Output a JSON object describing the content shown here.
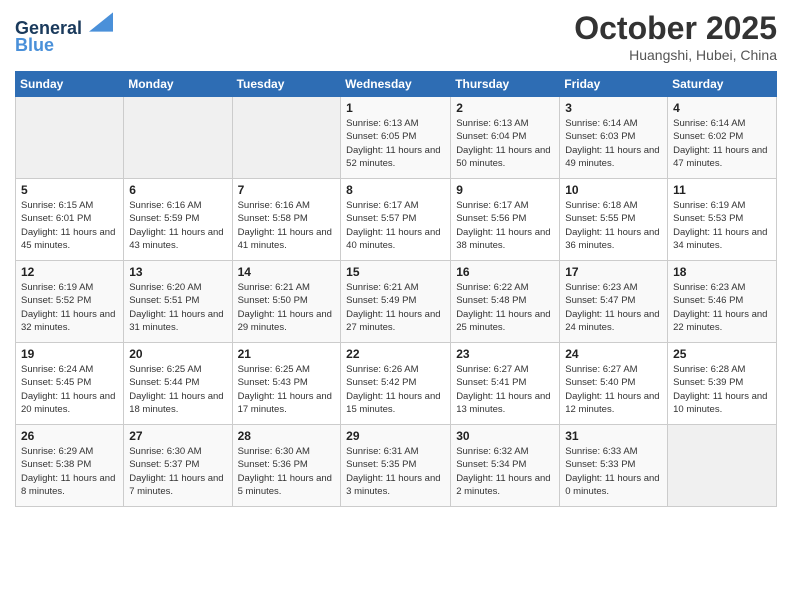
{
  "header": {
    "logo_line1": "General",
    "logo_line2": "Blue",
    "month_title": "October 2025",
    "location": "Huangshi, Hubei, China"
  },
  "weekdays": [
    "Sunday",
    "Monday",
    "Tuesday",
    "Wednesday",
    "Thursday",
    "Friday",
    "Saturday"
  ],
  "weeks": [
    [
      {
        "day": "",
        "sunrise": "",
        "sunset": "",
        "daylight": "",
        "empty": true
      },
      {
        "day": "",
        "sunrise": "",
        "sunset": "",
        "daylight": "",
        "empty": true
      },
      {
        "day": "",
        "sunrise": "",
        "sunset": "",
        "daylight": "",
        "empty": true
      },
      {
        "day": "1",
        "sunrise": "Sunrise: 6:13 AM",
        "sunset": "Sunset: 6:05 PM",
        "daylight": "Daylight: 11 hours and 52 minutes."
      },
      {
        "day": "2",
        "sunrise": "Sunrise: 6:13 AM",
        "sunset": "Sunset: 6:04 PM",
        "daylight": "Daylight: 11 hours and 50 minutes."
      },
      {
        "day": "3",
        "sunrise": "Sunrise: 6:14 AM",
        "sunset": "Sunset: 6:03 PM",
        "daylight": "Daylight: 11 hours and 49 minutes."
      },
      {
        "day": "4",
        "sunrise": "Sunrise: 6:14 AM",
        "sunset": "Sunset: 6:02 PM",
        "daylight": "Daylight: 11 hours and 47 minutes."
      }
    ],
    [
      {
        "day": "5",
        "sunrise": "Sunrise: 6:15 AM",
        "sunset": "Sunset: 6:01 PM",
        "daylight": "Daylight: 11 hours and 45 minutes."
      },
      {
        "day": "6",
        "sunrise": "Sunrise: 6:16 AM",
        "sunset": "Sunset: 5:59 PM",
        "daylight": "Daylight: 11 hours and 43 minutes."
      },
      {
        "day": "7",
        "sunrise": "Sunrise: 6:16 AM",
        "sunset": "Sunset: 5:58 PM",
        "daylight": "Daylight: 11 hours and 41 minutes."
      },
      {
        "day": "8",
        "sunrise": "Sunrise: 6:17 AM",
        "sunset": "Sunset: 5:57 PM",
        "daylight": "Daylight: 11 hours and 40 minutes."
      },
      {
        "day": "9",
        "sunrise": "Sunrise: 6:17 AM",
        "sunset": "Sunset: 5:56 PM",
        "daylight": "Daylight: 11 hours and 38 minutes."
      },
      {
        "day": "10",
        "sunrise": "Sunrise: 6:18 AM",
        "sunset": "Sunset: 5:55 PM",
        "daylight": "Daylight: 11 hours and 36 minutes."
      },
      {
        "day": "11",
        "sunrise": "Sunrise: 6:19 AM",
        "sunset": "Sunset: 5:53 PM",
        "daylight": "Daylight: 11 hours and 34 minutes."
      }
    ],
    [
      {
        "day": "12",
        "sunrise": "Sunrise: 6:19 AM",
        "sunset": "Sunset: 5:52 PM",
        "daylight": "Daylight: 11 hours and 32 minutes."
      },
      {
        "day": "13",
        "sunrise": "Sunrise: 6:20 AM",
        "sunset": "Sunset: 5:51 PM",
        "daylight": "Daylight: 11 hours and 31 minutes."
      },
      {
        "day": "14",
        "sunrise": "Sunrise: 6:21 AM",
        "sunset": "Sunset: 5:50 PM",
        "daylight": "Daylight: 11 hours and 29 minutes."
      },
      {
        "day": "15",
        "sunrise": "Sunrise: 6:21 AM",
        "sunset": "Sunset: 5:49 PM",
        "daylight": "Daylight: 11 hours and 27 minutes."
      },
      {
        "day": "16",
        "sunrise": "Sunrise: 6:22 AM",
        "sunset": "Sunset: 5:48 PM",
        "daylight": "Daylight: 11 hours and 25 minutes."
      },
      {
        "day": "17",
        "sunrise": "Sunrise: 6:23 AM",
        "sunset": "Sunset: 5:47 PM",
        "daylight": "Daylight: 11 hours and 24 minutes."
      },
      {
        "day": "18",
        "sunrise": "Sunrise: 6:23 AM",
        "sunset": "Sunset: 5:46 PM",
        "daylight": "Daylight: 11 hours and 22 minutes."
      }
    ],
    [
      {
        "day": "19",
        "sunrise": "Sunrise: 6:24 AM",
        "sunset": "Sunset: 5:45 PM",
        "daylight": "Daylight: 11 hours and 20 minutes."
      },
      {
        "day": "20",
        "sunrise": "Sunrise: 6:25 AM",
        "sunset": "Sunset: 5:44 PM",
        "daylight": "Daylight: 11 hours and 18 minutes."
      },
      {
        "day": "21",
        "sunrise": "Sunrise: 6:25 AM",
        "sunset": "Sunset: 5:43 PM",
        "daylight": "Daylight: 11 hours and 17 minutes."
      },
      {
        "day": "22",
        "sunrise": "Sunrise: 6:26 AM",
        "sunset": "Sunset: 5:42 PM",
        "daylight": "Daylight: 11 hours and 15 minutes."
      },
      {
        "day": "23",
        "sunrise": "Sunrise: 6:27 AM",
        "sunset": "Sunset: 5:41 PM",
        "daylight": "Daylight: 11 hours and 13 minutes."
      },
      {
        "day": "24",
        "sunrise": "Sunrise: 6:27 AM",
        "sunset": "Sunset: 5:40 PM",
        "daylight": "Daylight: 11 hours and 12 minutes."
      },
      {
        "day": "25",
        "sunrise": "Sunrise: 6:28 AM",
        "sunset": "Sunset: 5:39 PM",
        "daylight": "Daylight: 11 hours and 10 minutes."
      }
    ],
    [
      {
        "day": "26",
        "sunrise": "Sunrise: 6:29 AM",
        "sunset": "Sunset: 5:38 PM",
        "daylight": "Daylight: 11 hours and 8 minutes."
      },
      {
        "day": "27",
        "sunrise": "Sunrise: 6:30 AM",
        "sunset": "Sunset: 5:37 PM",
        "daylight": "Daylight: 11 hours and 7 minutes."
      },
      {
        "day": "28",
        "sunrise": "Sunrise: 6:30 AM",
        "sunset": "Sunset: 5:36 PM",
        "daylight": "Daylight: 11 hours and 5 minutes."
      },
      {
        "day": "29",
        "sunrise": "Sunrise: 6:31 AM",
        "sunset": "Sunset: 5:35 PM",
        "daylight": "Daylight: 11 hours and 3 minutes."
      },
      {
        "day": "30",
        "sunrise": "Sunrise: 6:32 AM",
        "sunset": "Sunset: 5:34 PM",
        "daylight": "Daylight: 11 hours and 2 minutes."
      },
      {
        "day": "31",
        "sunrise": "Sunrise: 6:33 AM",
        "sunset": "Sunset: 5:33 PM",
        "daylight": "Daylight: 11 hours and 0 minutes."
      },
      {
        "day": "",
        "sunrise": "",
        "sunset": "",
        "daylight": "",
        "empty": true
      }
    ]
  ]
}
